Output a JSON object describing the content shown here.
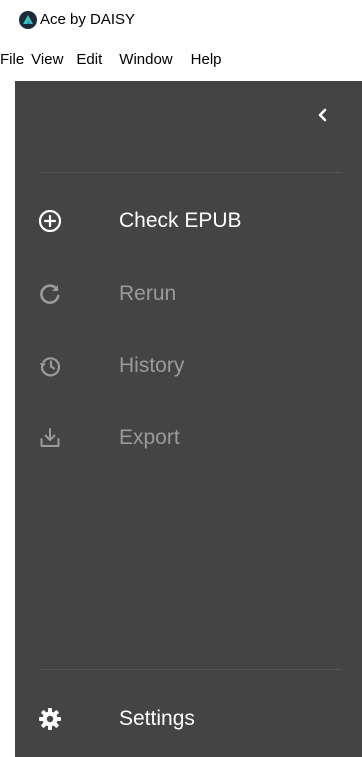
{
  "window": {
    "title": "Ace by DAISY"
  },
  "menu": {
    "items": [
      "File",
      "View",
      "Edit",
      "Window",
      "Help"
    ]
  },
  "sidebar": {
    "collapse_icon": "chevron-left-icon",
    "nav": [
      {
        "label": "Check EPUB",
        "icon": "plus-circle-icon",
        "state": "active"
      },
      {
        "label": "Rerun",
        "icon": "refresh-icon",
        "state": "disabled"
      },
      {
        "label": "History",
        "icon": "history-icon",
        "state": "disabled"
      },
      {
        "label": "Export",
        "icon": "download-icon",
        "state": "disabled"
      }
    ],
    "settings": {
      "label": "Settings",
      "icon": "gear-icon",
      "state": "active"
    }
  },
  "colors": {
    "sidebar_bg": "#444444",
    "active_text": "#ffffff",
    "disabled_text": "#9a9a9a",
    "logo": "#1aa7a0"
  }
}
